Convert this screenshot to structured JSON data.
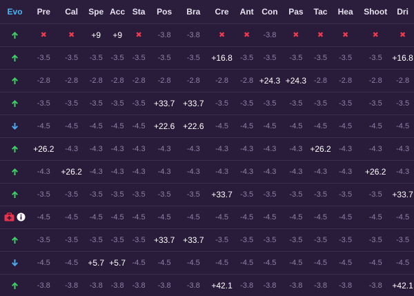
{
  "columns": [
    "Evo",
    "Pre",
    "Cal",
    "Spe",
    "Acc",
    "Sta",
    "Pos",
    "Bra",
    "Cre",
    "Ant",
    "Con",
    "Pas",
    "Tac",
    "Hea",
    "Shoot",
    "Dri"
  ],
  "colors": {
    "up": "#3ccf63",
    "down": "#4aa8f0",
    "cross": "#ef3b4f",
    "medkit": "#e8334a",
    "evo_header": "#4cb6f0"
  },
  "rows": [
    {
      "evo": "up",
      "cells": [
        "x",
        "x",
        "+9",
        "+9",
        "x",
        "-3.8",
        "-3.8",
        "x",
        "x",
        "-3.8",
        "x",
        "x",
        "x",
        "x",
        "x"
      ]
    },
    {
      "evo": "up",
      "cells": [
        "-3.5",
        "-3.5",
        "-3.5",
        "-3.5",
        "-3.5",
        "-3.5",
        "-3.5",
        "+16.8",
        "-3.5",
        "-3.5",
        "-3.5",
        "-3.5",
        "-3.5",
        "-3.5",
        "+16.8"
      ]
    },
    {
      "evo": "up",
      "cells": [
        "-2.8",
        "-2.8",
        "-2.8",
        "-2.8",
        "-2.8",
        "-2.8",
        "-2.8",
        "-2.8",
        "-2.8",
        "+24.3",
        "+24.3",
        "-2.8",
        "-2.8",
        "-2.8",
        "-2.8"
      ]
    },
    {
      "evo": "up",
      "cells": [
        "-3.5",
        "-3.5",
        "-3.5",
        "-3.5",
        "-3.5",
        "+33.7",
        "+33.7",
        "-3.5",
        "-3.5",
        "-3.5",
        "-3.5",
        "-3.5",
        "-3.5",
        "-3.5",
        "-3.5"
      ]
    },
    {
      "evo": "down",
      "cells": [
        "-4.5",
        "-4.5",
        "-4.5",
        "-4.5",
        "-4.5",
        "+22.6",
        "+22.6",
        "-4.5",
        "-4.5",
        "-4.5",
        "-4.5",
        "-4.5",
        "-4.5",
        "-4.5",
        "-4.5"
      ]
    },
    {
      "evo": "up",
      "cells": [
        "+26.2",
        "-4.3",
        "-4.3",
        "-4.3",
        "-4.3",
        "-4.3",
        "-4.3",
        "-4.3",
        "-4.3",
        "-4.3",
        "-4.3",
        "+26.2",
        "-4.3",
        "-4.3",
        "-4.3"
      ]
    },
    {
      "evo": "up",
      "cells": [
        "-4.3",
        "+26.2",
        "-4.3",
        "-4.3",
        "-4.3",
        "-4.3",
        "-4.3",
        "-4.3",
        "-4.3",
        "-4.3",
        "-4.3",
        "-4.3",
        "-4.3",
        "+26.2",
        "-4.3"
      ]
    },
    {
      "evo": "up",
      "cells": [
        "-3.5",
        "-3.5",
        "-3.5",
        "-3.5",
        "-3.5",
        "-3.5",
        "-3.5",
        "+33.7",
        "-3.5",
        "-3.5",
        "-3.5",
        "-3.5",
        "-3.5",
        "-3.5",
        "+33.7"
      ]
    },
    {
      "evo": "medical",
      "cells": [
        "-4.5",
        "-4.5",
        "-4.5",
        "-4.5",
        "-4.5",
        "-4.5",
        "-4.5",
        "-4.5",
        "-4.5",
        "-4.5",
        "-4.5",
        "-4.5",
        "-4.5",
        "-4.5",
        "-4.5"
      ]
    },
    {
      "evo": "up",
      "cells": [
        "-3.5",
        "-3.5",
        "-3.5",
        "-3.5",
        "-3.5",
        "+33.7",
        "+33.7",
        "-3.5",
        "-3.5",
        "-3.5",
        "-3.5",
        "-3.5",
        "-3.5",
        "-3.5",
        "-3.5"
      ]
    },
    {
      "evo": "down",
      "cells": [
        "-4.5",
        "-4.5",
        "+5.7",
        "+5.7",
        "-4.5",
        "-4.5",
        "-4.5",
        "-4.5",
        "-4.5",
        "-4.5",
        "-4.5",
        "-4.5",
        "-4.5",
        "-4.5",
        "-4.5"
      ]
    },
    {
      "evo": "up",
      "cells": [
        "-3.8",
        "-3.8",
        "-3.8",
        "-3.8",
        "-3.8",
        "-3.8",
        "-3.8",
        "+42.1",
        "-3.8",
        "-3.8",
        "-3.8",
        "-3.8",
        "-3.8",
        "-3.8",
        "+42.1"
      ]
    }
  ]
}
